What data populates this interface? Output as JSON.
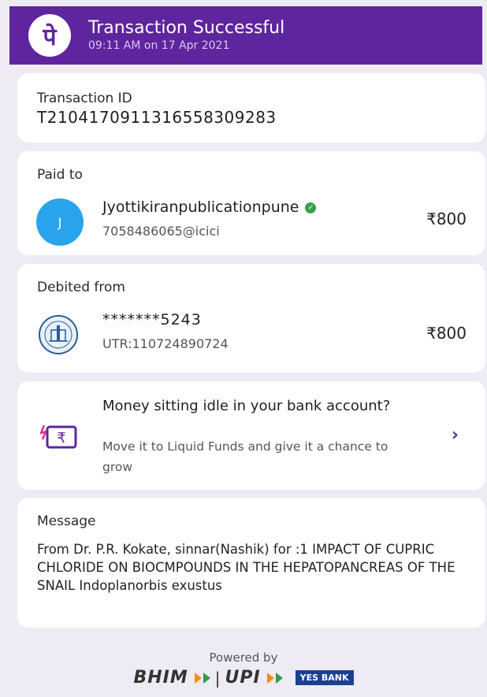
{
  "header": {
    "logo_glyph": "पे",
    "title": "Transaction Successful",
    "subtitle": "09:11 AM on 17 Apr 2021"
  },
  "transaction": {
    "label": "Transaction ID",
    "id": "T2104170911316558309283"
  },
  "paid_to": {
    "label": "Paid to",
    "avatar_initial": "J",
    "name": "Jyottikiranpublicationpune",
    "upi_id": "7058486065@icici",
    "amount": "₹800"
  },
  "debited_from": {
    "label": "Debited from",
    "account": "*******5243",
    "utr": "UTR:110724890724",
    "amount": "₹800"
  },
  "promo": {
    "title": "Money sitting idle in your bank account?",
    "body": "Move it to Liquid Funds and give it a chance to grow",
    "icon_glyph": "₹"
  },
  "message": {
    "label": "Message",
    "text": "From Dr. P.R. Kokate, sinnar(Nashik) for :1 IMPACT OF CUPRIC CHLORIDE ON BIOCMPOUNDS IN THE HEPATOPANCREAS OF THE SNAIL Indoplanorbis exustus"
  },
  "footer": {
    "powered_by": "Powered by",
    "bhim": "BHIM",
    "upi": "UPI",
    "sep": "|",
    "yes_bank": "YES BANK"
  },
  "colors": {
    "brand": "#5f259f",
    "avatar": "#29a3ec",
    "verified": "#3aa04a",
    "background": "#eeebf4"
  }
}
